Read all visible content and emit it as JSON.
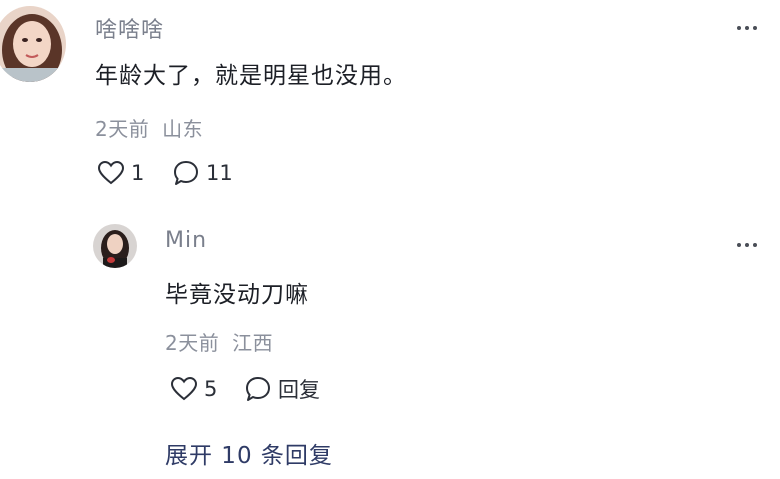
{
  "comment": {
    "username": "啥啥啥",
    "text": "年龄大了，就是明星也没用。",
    "time": "2天前",
    "location": "山东",
    "likes": "1",
    "replies": "11"
  },
  "reply": {
    "username": "Min",
    "text": "毕竟没动刀嘛",
    "time": "2天前",
    "location": "江西",
    "likes": "5",
    "reply_label": "回复"
  },
  "expand_label": "展开 10 条回复",
  "icons": {
    "like": "heart-outline-icon",
    "comment": "speech-bubble-icon",
    "more": "more-horizontal-icon"
  },
  "colors": {
    "expand_link": "#2f3b66",
    "meta": "#8b909c",
    "username": "#7a7f8c"
  }
}
